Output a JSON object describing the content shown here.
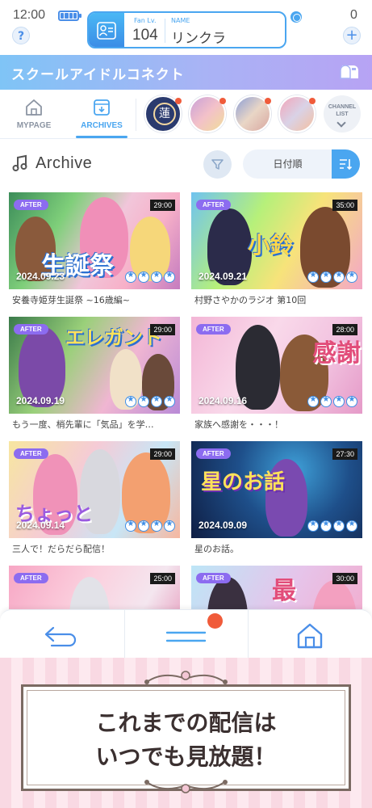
{
  "status": {
    "time": "12:00",
    "fan_label": "Fan Lv.",
    "fan_level": "104",
    "name_label": "NAME",
    "name": "リンクラ",
    "coins": "0",
    "help_icon": "?",
    "plus_icon": "+"
  },
  "banner": {
    "title": "スクールアイドルコネクト"
  },
  "tabs": [
    {
      "label": "MYPAGE"
    },
    {
      "label": "ARCHIVES"
    }
  ],
  "channel_logo_text": "蓮",
  "channel_list": {
    "label_1": "CHANNEL",
    "label_2": "LIST"
  },
  "archive": {
    "title": "Archive",
    "sort_value": "日付順"
  },
  "cards": [
    {
      "badge": "AFTER",
      "duration": "29:00",
      "date": "2024.09.23",
      "title": "安養寺姫芽生誕祭 ~16歳編~",
      "art_text": "生誕祭",
      "stars": 4
    },
    {
      "badge": "AFTER",
      "duration": "35:00",
      "date": "2024.09.21",
      "title": "村野さやかのラジオ 第10回",
      "art_text": "小鈴",
      "stars": 4
    },
    {
      "badge": "AFTER",
      "duration": "29:00",
      "date": "2024.09.19",
      "title": "もう一度、梢先輩に「気品」を学…",
      "art_text": "エレガント",
      "stars": 4
    },
    {
      "badge": "AFTER",
      "duration": "28:00",
      "date": "2024.09.16",
      "title": "家族へ感謝を・・・！",
      "art_text": "感謝",
      "stars": 4
    },
    {
      "badge": "AFTER",
      "duration": "29:00",
      "date": "2024.09.14",
      "title": "三人で！だらだら配信！",
      "art_text": "ちょっと",
      "stars": 4
    },
    {
      "badge": "AFTER",
      "duration": "27:30",
      "date": "2024.09.09",
      "title": "星のお話。",
      "art_text": "星のお話",
      "stars": 4
    },
    {
      "badge": "AFTER",
      "duration": "25:00",
      "date": "",
      "title": "",
      "art_text": "",
      "stars": 0
    },
    {
      "badge": "AFTER",
      "duration": "30:00",
      "date": "",
      "title": "",
      "art_text": "最",
      "stars": 0
    }
  ],
  "promo": {
    "line1": "これまでの配信は",
    "line2": "いつでも見放題！"
  },
  "colors": {
    "accent": "#4aa6f0",
    "badge": "#8c6cf0",
    "notify": "#f05b3a"
  }
}
